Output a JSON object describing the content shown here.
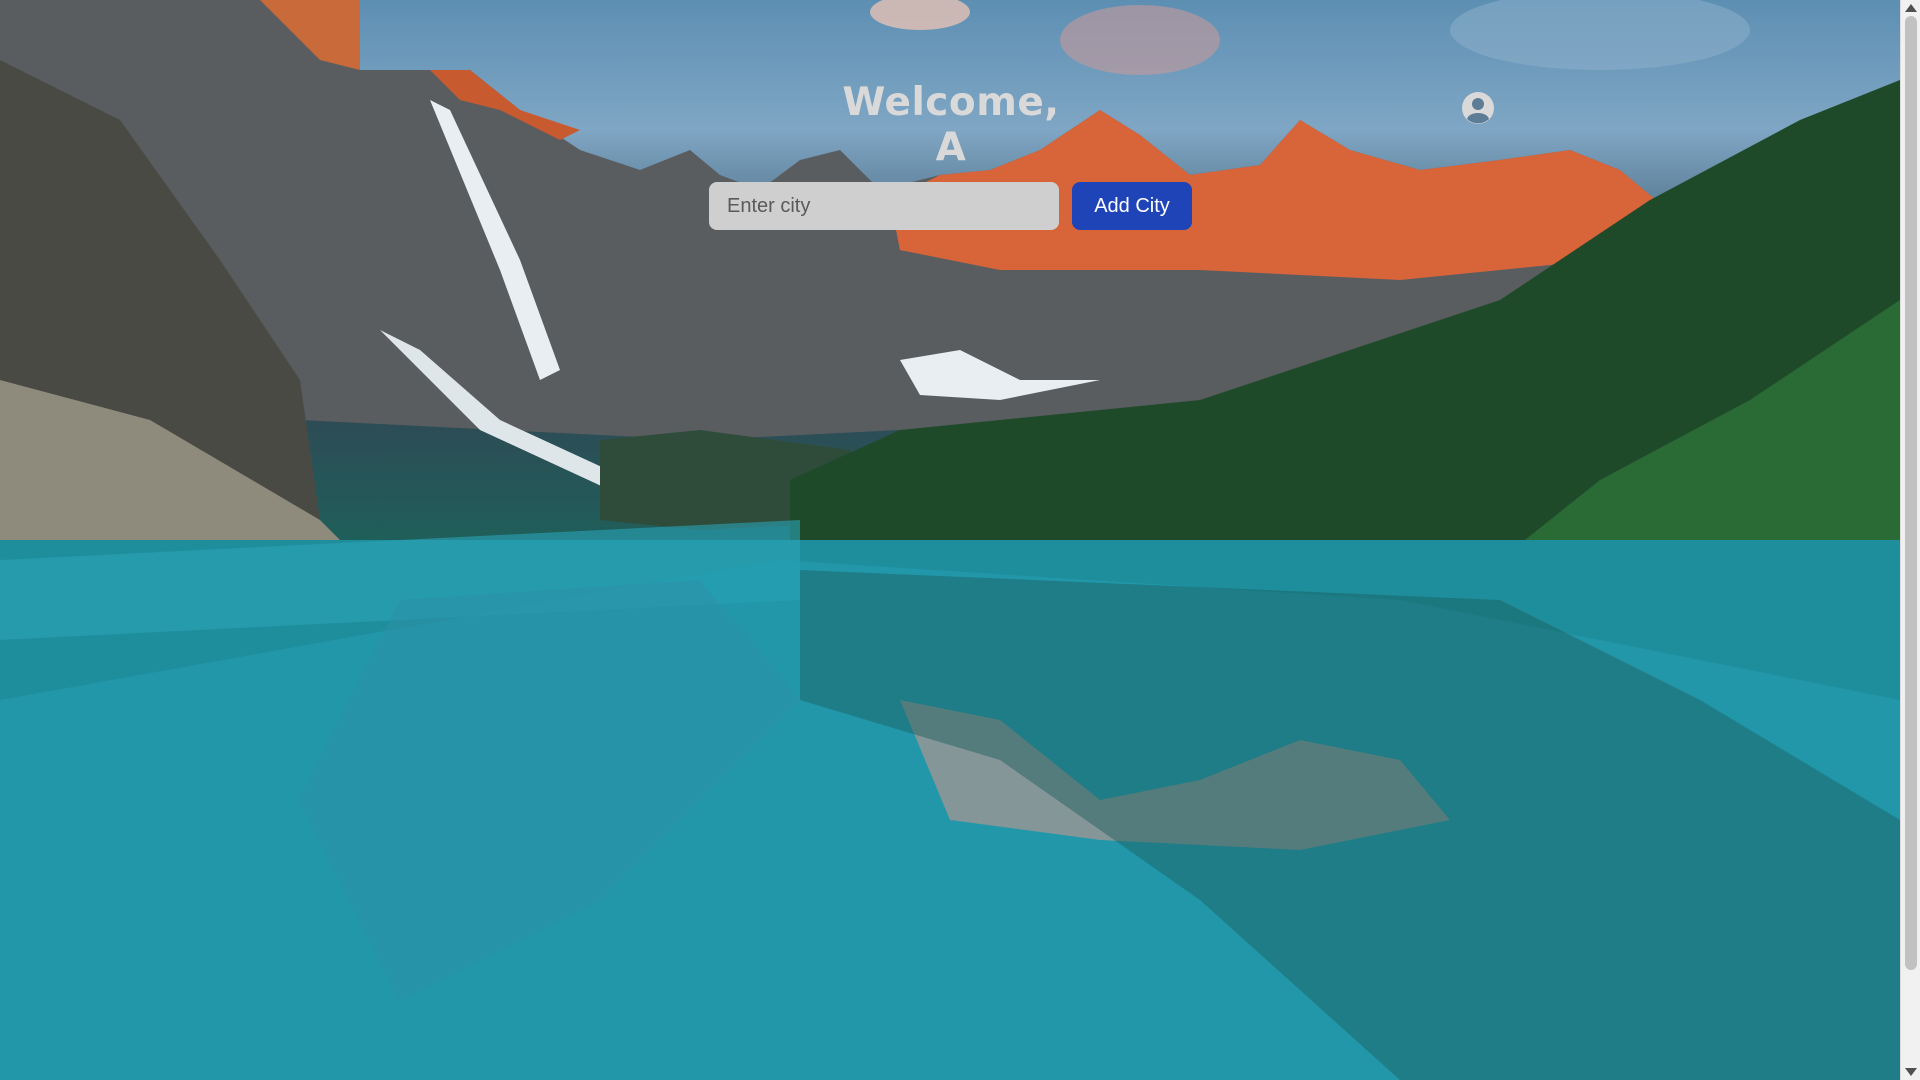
{
  "header": {
    "title": "Welcome, A"
  },
  "search": {
    "placeholder": "Enter city",
    "value": ""
  },
  "actions": {
    "add_city_label": "Add City"
  },
  "icons": {
    "profile": "user-circle-icon"
  },
  "colors": {
    "button": "#1e44b8",
    "title": "#d9d9d9",
    "input_bg": "#cfcfcf"
  }
}
